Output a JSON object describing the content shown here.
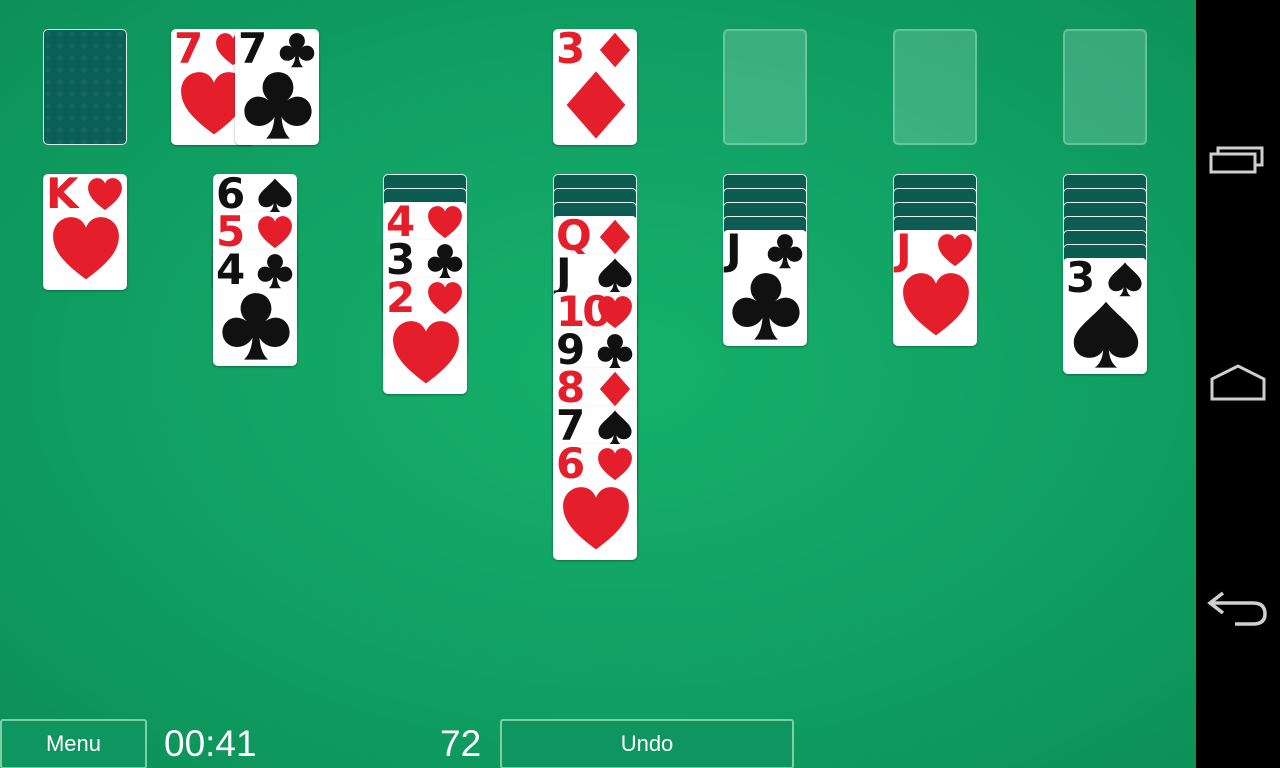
{
  "toolbar": {
    "menu_label": "Menu",
    "timer": "00:41",
    "score": "72",
    "undo_label": "Undo"
  },
  "stock": {
    "face_down": true
  },
  "waste": [
    {
      "rank": "7",
      "suit": "heart",
      "color": "red"
    },
    {
      "rank": "7",
      "suit": "club",
      "color": "black"
    }
  ],
  "foundations": [
    {
      "rank": "3",
      "suit": "diamond",
      "color": "red"
    },
    {
      "empty": true
    },
    {
      "empty": true
    },
    {
      "empty": true
    }
  ],
  "tableau": [
    {
      "face_down_count": 0,
      "cards": [
        {
          "rank": "K",
          "suit": "heart",
          "color": "red"
        }
      ]
    },
    {
      "face_down_count": 0,
      "cards": [
        {
          "rank": "6",
          "suit": "spade",
          "color": "black"
        },
        {
          "rank": "5",
          "suit": "heart",
          "color": "red"
        },
        {
          "rank": "4",
          "suit": "club",
          "color": "black"
        }
      ]
    },
    {
      "face_down_count": 2,
      "cards": [
        {
          "rank": "4",
          "suit": "heart",
          "color": "red"
        },
        {
          "rank": "3",
          "suit": "club",
          "color": "black"
        },
        {
          "rank": "2",
          "suit": "heart",
          "color": "red"
        }
      ]
    },
    {
      "face_down_count": 3,
      "cards": [
        {
          "rank": "Q",
          "suit": "diamond",
          "color": "red"
        },
        {
          "rank": "J",
          "suit": "spade",
          "color": "black"
        },
        {
          "rank": "10",
          "suit": "heart",
          "color": "red"
        },
        {
          "rank": "9",
          "suit": "club",
          "color": "black"
        },
        {
          "rank": "8",
          "suit": "diamond",
          "color": "red"
        },
        {
          "rank": "7",
          "suit": "spade",
          "color": "black"
        },
        {
          "rank": "6",
          "suit": "heart",
          "color": "red"
        }
      ]
    },
    {
      "face_down_count": 4,
      "cards": [
        {
          "rank": "J",
          "suit": "club",
          "color": "black"
        }
      ]
    },
    {
      "face_down_count": 4,
      "cards": [
        {
          "rank": "J",
          "suit": "heart",
          "color": "red"
        }
      ]
    },
    {
      "face_down_count": 6,
      "cards": [
        {
          "rank": "3",
          "suit": "spade",
          "color": "black"
        }
      ]
    }
  ],
  "system_nav": [
    {
      "name": "recent-apps-icon"
    },
    {
      "name": "home-icon"
    },
    {
      "name": "back-icon"
    }
  ],
  "colors": {
    "table": "#10a063",
    "card_back": "#0a5f56",
    "red_suit": "#e41f2b",
    "black_suit": "#111111"
  }
}
